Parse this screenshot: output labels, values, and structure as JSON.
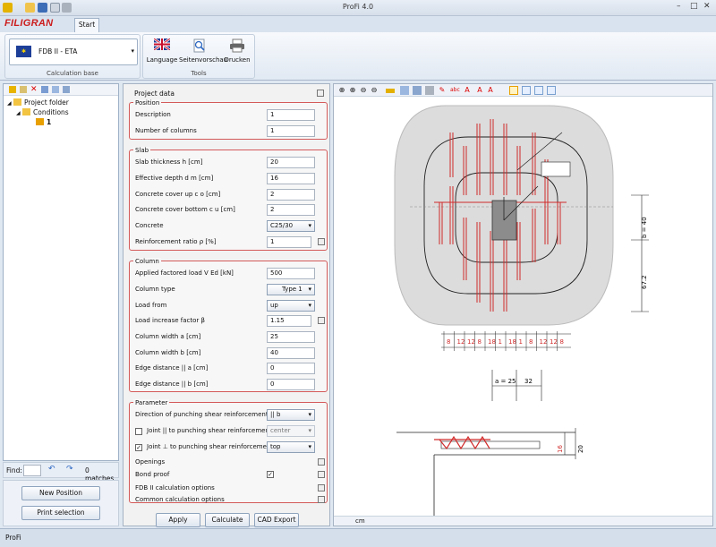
{
  "window": {
    "title": "ProFi 4.0",
    "minimize": "–",
    "maximize": "□",
    "close": "✕"
  },
  "app": {
    "logo": "FILIGRAN",
    "tab_start": "Start"
  },
  "ribbon": {
    "calc_base_value": "FDB II - ETA",
    "calc_base_group": "Calculation base",
    "tools_group": "Tools",
    "language_label": "Language",
    "preview_label": "Seitenvorschau",
    "print_label": "Drucken"
  },
  "tree": {
    "root": "Project folder",
    "conditions": "Conditions",
    "item": "1"
  },
  "find": {
    "label": "Find:",
    "matches": "0 matches"
  },
  "left_buttons": {
    "new_position": "New Position",
    "print_selection": "Print selection"
  },
  "form": {
    "project_data": "Project data",
    "position": {
      "title": "Position",
      "description_label": "Description",
      "description_value": "1",
      "columns_label": "Number of columns",
      "columns_value": "1"
    },
    "slab": {
      "title": "Slab",
      "thickness_label": "Slab thickness h  [cm]",
      "thickness_value": "20",
      "depth_label": "Effective depth d m [cm]",
      "depth_value": "16",
      "cover_up_label": "Concrete cover up c o [cm]",
      "cover_up_value": "2",
      "cover_bottom_label": "Concrete cover bottom c u [cm]",
      "cover_bottom_value": "2",
      "concrete_label": "Concrete",
      "concrete_value": "C25/30",
      "ratio_label": "Reinforcement ratio ρ  [%]",
      "ratio_value": "1"
    },
    "column": {
      "title": "Column",
      "load_label": "Applied factored load V Ed [kN]",
      "load_value": "500",
      "type_label": "Column type",
      "type_value": "Type 1",
      "loadfrom_label": "Load from",
      "loadfrom_value": "up",
      "factor_label": "Load increase factor β",
      "factor_value": "1.15",
      "width_a_label": "Column width a  [cm]",
      "width_a_value": "25",
      "width_b_label": "Column width b  [cm]",
      "width_b_value": "40",
      "edge_a_label": "Edge distance || a  [cm]",
      "edge_a_value": "0",
      "edge_b_label": "Edge distance || b  [cm]",
      "edge_b_value": "0"
    },
    "parameter": {
      "title": "Parameter",
      "direction_label": "Direction of punching shear reinforcement",
      "direction_value": "|| b",
      "joint_par_label": "Joint || to punching shear reinforcement",
      "joint_par_value": "center",
      "joint_perp_label": "Joint ⊥ to punching shear reinforcement",
      "joint_perp_value": "top",
      "openings_label": "Openings",
      "bond_label": "Bond proof",
      "fdb_label": "FDB II calculation options",
      "common_label": "Common calculation options"
    },
    "buttons": {
      "apply": "Apply",
      "calculate": "Calculate",
      "cad": "CAD Export"
    }
  },
  "drawing": {
    "dim_b": "b = 40",
    "dim_672": "67.2",
    "dim_a": "a = 25",
    "dim_32": "32",
    "row_labels": [
      "8",
      "12",
      "12",
      "8",
      "18",
      "1",
      "18",
      "1",
      "8",
      "12",
      "12",
      "8"
    ],
    "section_16": "16",
    "section_20": "20",
    "unit": "cm"
  },
  "status": {
    "text": "ProFi"
  },
  "colors": {
    "accent_red": "#d12a2a",
    "slab_gray": "#dcdcdc",
    "column_gray": "#8c8c8c"
  }
}
